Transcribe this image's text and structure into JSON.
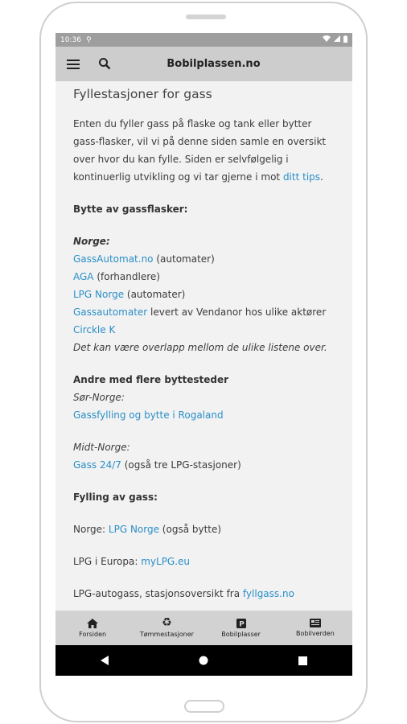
{
  "statusbar": {
    "time": "10:36"
  },
  "appbar": {
    "title": "Bobilplassen.no"
  },
  "content": {
    "heading": "Fyllestasjoner for gass",
    "intro_text": "Enten du fyller gass på flaske og tank eller bytter gass-flasker, vil vi på denne siden samle en oversikt over hvor du kan fylle.  Siden er selvfølgelig i kontinuerlig utvikling og vi tar gjerne i mot",
    "intro_link": "ditt tips",
    "intro_end": ".",
    "section_swap": "Bytte av gassflasker:",
    "norge_label": "Norge:",
    "swap_items": [
      {
        "link": "GassAutomat.no",
        "text": " (automater)"
      },
      {
        "link": "AGA",
        "text": " (forhandlere)"
      },
      {
        "link": "LPG Norge",
        "text": " (automater)"
      },
      {
        "link": "Gassautomater",
        "text": " levert av Vendanor hos ulike aktører"
      },
      {
        "link": "Circkle K",
        "text": ""
      }
    ],
    "overlap_note": "Det kan være overlapp mellom de ulike listene over.",
    "section_others": "Andre med flere byttesteder",
    "region_south": "Sør-Norge:",
    "south_link": "Gassfylling og bytte i Rogaland",
    "region_mid": "Midt-Norge:",
    "mid_link": "Gass 24/7",
    "mid_text": " (også tre LPG-stasjoner)",
    "section_fill": "Fylling av gass:",
    "fill_norge_prefix": "Norge: ",
    "fill_norge_link": "LPG Norge",
    "fill_norge_text": " (også bytte)",
    "fill_europe_prefix": "LPG i Europa: ",
    "fill_europe_link": "myLPG.eu",
    "fill_auto_prefix": "LPG-autogass, stasjonsoversikt fra ",
    "fill_auto_link": "fyllgass.no"
  },
  "bottomnav": [
    {
      "label": "Forsiden",
      "icon": "home-icon"
    },
    {
      "label": "Tømmestasjoner",
      "icon": "recycle-icon"
    },
    {
      "label": "Bobilplasser",
      "icon": "parking-icon"
    },
    {
      "label": "Bobilverden",
      "icon": "news-icon"
    }
  ],
  "colors": {
    "link": "#2a8fc7",
    "appbar": "#cdcdcd",
    "statusbar": "#9e9e9e"
  }
}
